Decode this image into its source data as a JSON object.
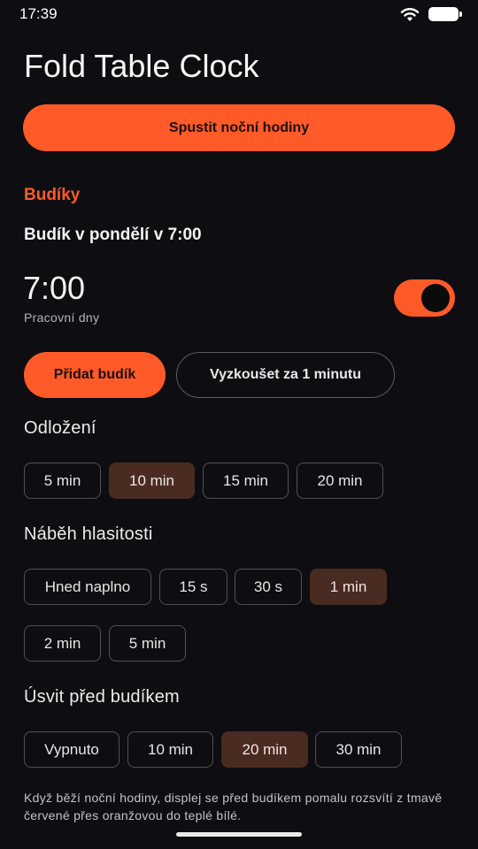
{
  "status_bar": {
    "time": "17:39",
    "wifi_icon": "wifi-icon",
    "battery_icon": "battery-icon"
  },
  "app": {
    "title": "Fold Table Clock"
  },
  "actions": {
    "start_night_clock": "Spustit noční hodiny"
  },
  "alarms": {
    "section_title": "Budíky",
    "alarm_name": "Budík v pondělí v 7:00",
    "time": "7:00",
    "days": "Pracovní dny",
    "enabled": true,
    "add_alarm": "Přidat budík",
    "try_in_minute": "Vyzkoušet za 1 minutu"
  },
  "snooze": {
    "label": "Odložení",
    "options": [
      "5 min",
      "10 min",
      "15 min",
      "20 min"
    ],
    "selected": "10 min"
  },
  "volume_ramp": {
    "label": "Náběh hlasitosti",
    "options": [
      "Hned naplno",
      "15 s",
      "30 s",
      "1 min",
      "2 min",
      "5 min"
    ],
    "selected": "1 min"
  },
  "sunrise": {
    "label": "Úsvit před budíkem",
    "options": [
      "Vypnuto",
      "10 min",
      "20 min",
      "30 min"
    ],
    "selected": "20 min"
  },
  "note": "Když běží noční hodiny, displej se před budíkem pomalu rozsvítí z tmavě červené přes oranžovou do teplé bílé.",
  "colors": {
    "accent": "#ff5a28",
    "background": "#0e0e12",
    "chip_selected": "#4a2b22"
  }
}
